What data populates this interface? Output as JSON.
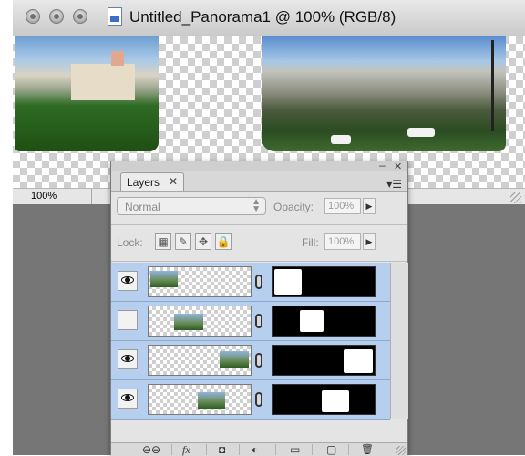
{
  "window": {
    "title": "Untitled_Panorama1 @ 100% (RGB/8)",
    "zoom": "100%"
  },
  "layers_panel": {
    "tab_label": "Layers",
    "tab_close": "✕",
    "panel_menu": "▾☰",
    "collapse": "–",
    "close": "✕",
    "blend_mode": "Normal",
    "opacity_label": "Opacity:",
    "opacity_value": "100%",
    "lock_label": "Lock:",
    "fill_label": "Fill:",
    "fill_value": "100%",
    "lock_icons": [
      "transparent-pixels-lock-icon",
      "image-pixels-lock-icon",
      "position-lock-icon",
      "all-lock-icon"
    ],
    "layers": [
      {
        "visible": true
      },
      {
        "visible": false
      },
      {
        "visible": true
      },
      {
        "visible": true
      }
    ],
    "bottom_buttons": {
      "link": "⊖⊖",
      "fx": "fx",
      "mask": "◘",
      "adjustment": "◐",
      "group": "▭",
      "new_layer": "▢",
      "delete": "🗑"
    }
  },
  "colors": {
    "workspace_gray": "#767676",
    "layer_selected_blue": "#b7cfee"
  }
}
